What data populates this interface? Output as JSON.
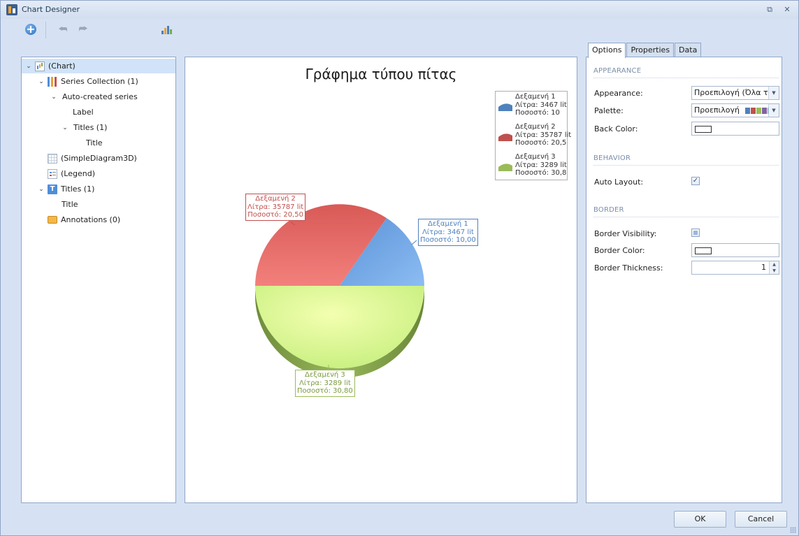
{
  "window": {
    "title": "Chart Designer",
    "restore_glyph": "⧉",
    "close_glyph": "✕"
  },
  "toolbar": {
    "add_icon": "add-circle-icon",
    "undo_icon": "undo-arrow-icon",
    "redo_icon": "redo-arrow-icon",
    "wizard_icon": "chart-wizard-icon"
  },
  "tree": {
    "items": [
      {
        "label": "(Chart)",
        "icon": "chart-icon"
      },
      {
        "label": "Series Collection (1)",
        "icon": "series-icon"
      },
      {
        "label": "Auto-created series"
      },
      {
        "label": "Label"
      },
      {
        "label": "Titles (1)"
      },
      {
        "label": "Title"
      },
      {
        "label": "(SimpleDiagram3D)",
        "icon": "diagram-icon"
      },
      {
        "label": "(Legend)",
        "icon": "legend-icon"
      },
      {
        "label": "Titles (1)",
        "icon": "title-icon"
      },
      {
        "label": "Title"
      },
      {
        "label": "Annotations (0)",
        "icon": "annotation-icon"
      }
    ]
  },
  "chart_data": {
    "type": "pie",
    "title": "Γράφημα τύπου πίτας",
    "slices": [
      {
        "name": "Δεξαμενή 1",
        "value": 3467,
        "unit": "lit",
        "percent": 10.0,
        "color": "#4f81bd",
        "label_lines": [
          "Δεξαμενή 1",
          "Λίτρα: 3467 lit",
          "Ποσοστό: 10,00"
        ],
        "legend_lines": [
          "Δεξαμενή 1",
          "Λίτρα: 3467 lit",
          "Ποσοστό: 10"
        ]
      },
      {
        "name": "Δεξαμενή 2",
        "value": 35787,
        "unit": "lit",
        "percent": 20.5,
        "color": "#c0504d",
        "label_lines": [
          "Δεξαμενή 2",
          "Λίτρα: 35787 lit",
          "Ποσοστό: 20,50"
        ],
        "legend_lines": [
          "Δεξαμενή 2",
          "Λίτρα: 35787 lit",
          "Ποσοστό: 20,5"
        ]
      },
      {
        "name": "Δεξαμενή 3",
        "value": 3289,
        "unit": "lit",
        "percent": 30.8,
        "color": "#9bbb59",
        "label_lines": [
          "Δεξαμενή 3",
          "Λίτρα: 3289 lit",
          "Ποσοστό: 30,80"
        ],
        "legend_lines": [
          "Δεξαμενή 3",
          "Λίτρα: 3289 lit",
          "Ποσοστό: 30,8"
        ]
      }
    ],
    "legend_position": "top-right"
  },
  "tabs": [
    "Options",
    "Properties",
    "Data"
  ],
  "properties": {
    "appearance_section": "APPEARANCE",
    "appearance_label": "Appearance:",
    "appearance_value": "Προεπιλογή (Όλα τ...",
    "palette_label": "Palette:",
    "palette_value": "Προεπιλογή",
    "palette_colors": [
      "#4f81bd",
      "#c0504d",
      "#9bbb59",
      "#8064a2",
      "#4bacc6"
    ],
    "back_color_label": "Back Color:",
    "behavior_section": "BEHAVIOR",
    "auto_layout_label": "Auto Layout:",
    "auto_layout_checked": true,
    "border_section": "BORDER",
    "border_visibility_label": "Border Visibility:",
    "border_visibility_checked": false,
    "border_color_label": "Border Color:",
    "border_thickness_label": "Border Thickness:",
    "border_thickness_value": "1"
  },
  "buttons": {
    "ok": "OK",
    "cancel": "Cancel"
  }
}
